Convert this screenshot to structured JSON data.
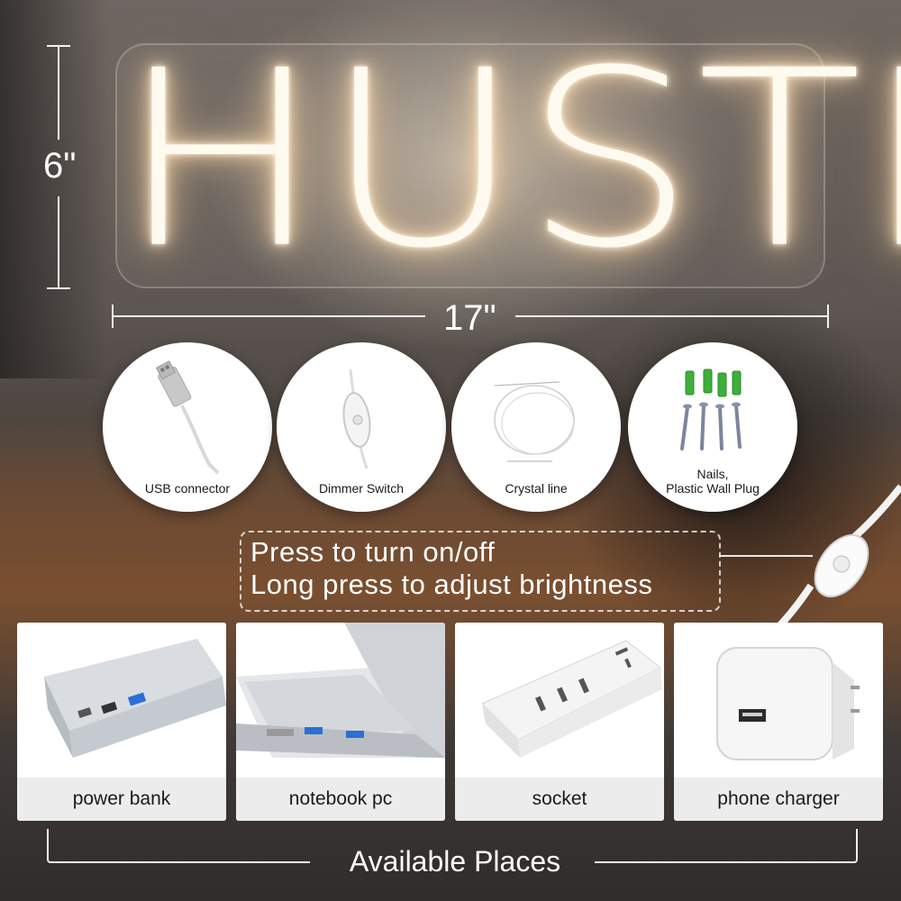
{
  "sign": {
    "text": "HUSTLE",
    "height_label": "6\"",
    "width_label": "17\""
  },
  "accessories": [
    {
      "label": "USB connector",
      "icon": "usb-connector-icon"
    },
    {
      "label": "Dimmer Switch",
      "icon": "dimmer-switch-icon"
    },
    {
      "label": "Crystal line",
      "icon": "crystal-line-icon"
    },
    {
      "label_line1": "Nails,",
      "label_line2": "Plastic Wall Plug",
      "icon": "nails-wall-plug-icon"
    }
  ],
  "instructions": {
    "line1": "Press to turn on/off",
    "line2": "Long press to adjust brightness"
  },
  "places": {
    "title": "Available Places",
    "items": [
      {
        "label": "power bank",
        "icon": "power-bank-icon"
      },
      {
        "label": "notebook pc",
        "icon": "notebook-pc-icon"
      },
      {
        "label": "socket",
        "icon": "socket-icon"
      },
      {
        "label": "phone charger",
        "icon": "phone-charger-icon"
      }
    ]
  },
  "colors": {
    "neon_glow": "#ffe6c0",
    "text_light": "#ffffff",
    "card_label_bg": "#ececec"
  }
}
